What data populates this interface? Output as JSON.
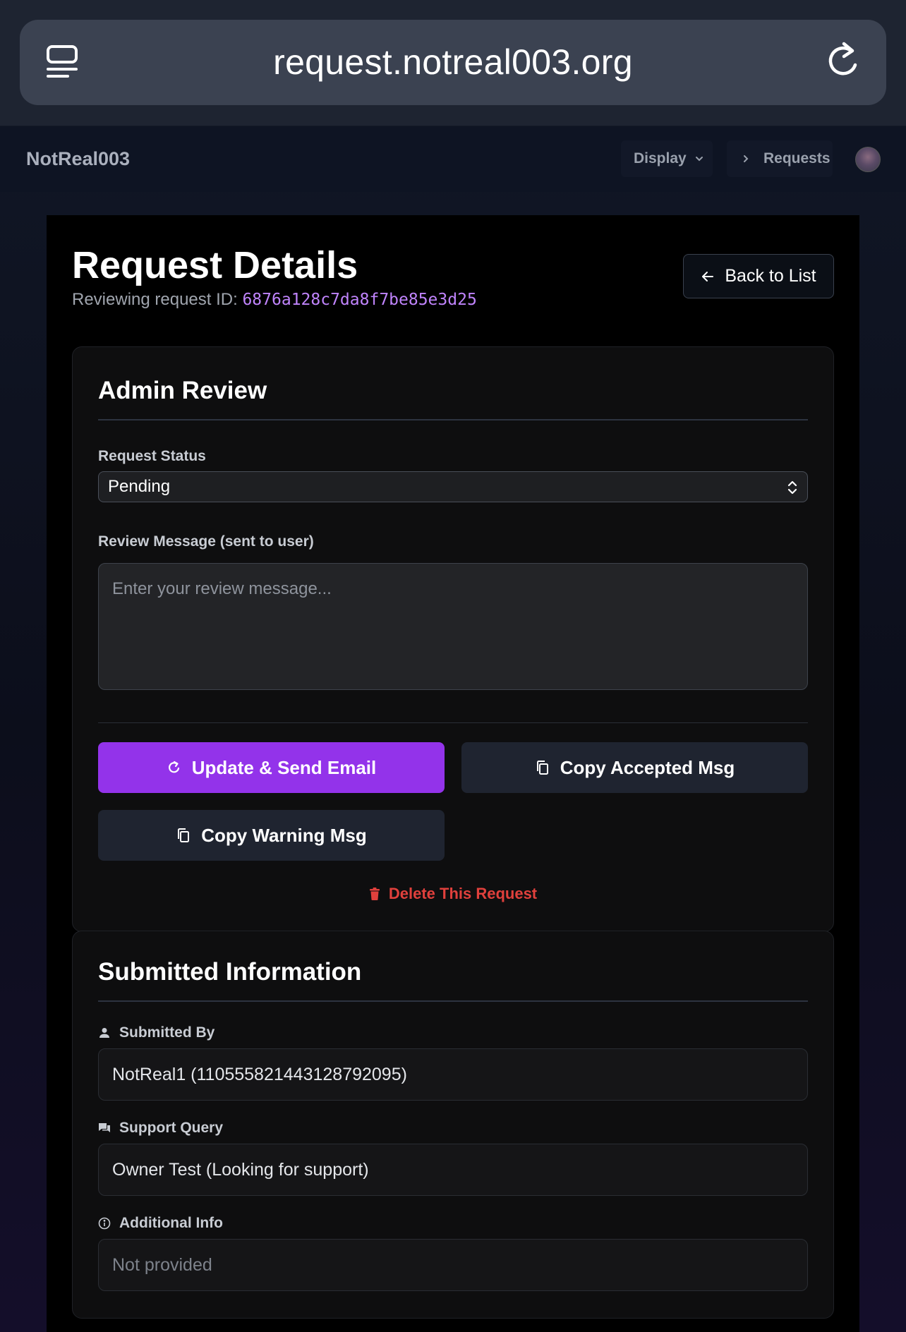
{
  "browser": {
    "url": "request.notreal003.org"
  },
  "header": {
    "brand": "NotReal003",
    "nav_display": "Display",
    "nav_requests": "Requests"
  },
  "page": {
    "title": "Request Details",
    "subtitle_prefix": "Reviewing request ID: ",
    "request_id": "6876a128c7da8f7be85e3d25",
    "back_label": "Back to List"
  },
  "admin_review": {
    "heading": "Admin Review",
    "status_label": "Request Status",
    "status_value": "Pending",
    "message_label": "Review Message (sent to user)",
    "message_placeholder": "Enter your review message...",
    "update_button": "Update & Send Email",
    "copy_accepted_button": "Copy Accepted Msg",
    "copy_warning_button": "Copy Warning Msg",
    "delete_link": "Delete This Request"
  },
  "submitted_info": {
    "heading": "Submitted Information",
    "submitted_by_label": "Submitted By",
    "submitted_by_value": "NotReal1 (1105558214431287920​95)",
    "support_query_label": "Support Query",
    "support_query_value": "Owner Test (Looking for support)",
    "additional_info_label": "Additional Info",
    "additional_info_value": "Not provided"
  },
  "colors": {
    "accent": "#9333ea",
    "request_id": "#c084fc",
    "danger": "#e0403c"
  }
}
